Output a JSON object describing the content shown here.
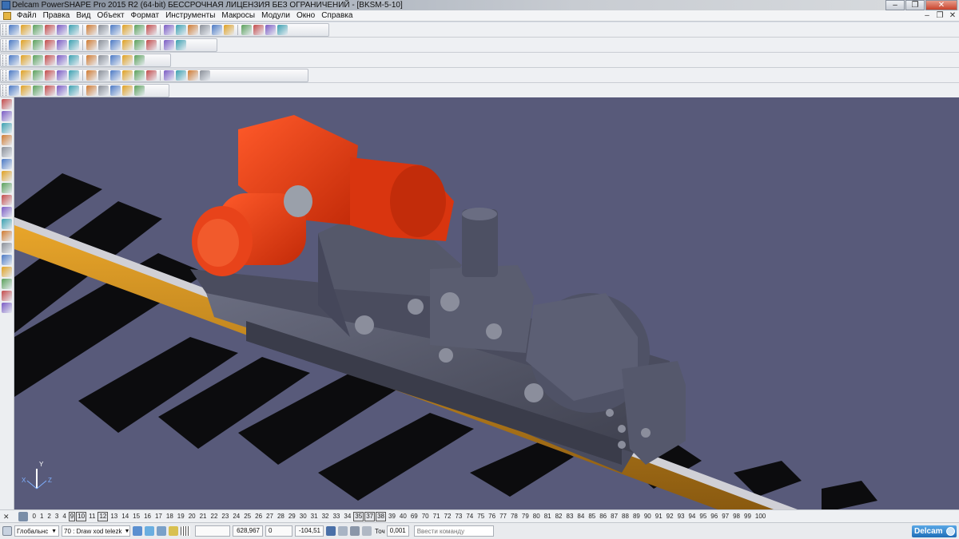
{
  "window": {
    "title": "Delcam PowerSHAPE Pro 2015 R2 (64-bit) БЕССРОЧНАЯ ЛИЦЕНЗИЯ БЕЗ ОГРАНИЧЕНИЙ - [BKSM-5-10]",
    "minimize": "–",
    "restore": "❐",
    "close": "✕"
  },
  "menu": {
    "items": [
      "Файл",
      "Правка",
      "Вид",
      "Объект",
      "Формат",
      "Инструменты",
      "Макросы",
      "Модули",
      "Окно",
      "Справка"
    ],
    "mdi": [
      "–",
      "❐",
      "✕"
    ]
  },
  "toolbars": {
    "row1_icons": [
      "new-file-icon",
      "open-icon",
      "save-icon",
      "save-as-icon",
      "print-icon",
      "print-preview-icon",
      "cut-icon",
      "copy-icon",
      "paste-icon",
      "delete-icon",
      "undo-icon",
      "redo-icon",
      "select-icon",
      "line-icon",
      "arc-icon",
      "curve-icon",
      "circle-icon",
      "dimension-icon",
      "workplane-icon",
      "shade-icon",
      "lights-icon",
      "tools-icon"
    ],
    "row2_icons": [
      "view-top-icon",
      "view-front-icon",
      "view-side-icon",
      "view-iso1-icon",
      "view-iso2-icon",
      "zoom-in-icon",
      "zoom-out-icon",
      "zoom-fit-icon",
      "zoom-box-icon",
      "rotate-icon",
      "shaded-icon",
      "wireframe-icon",
      "hidden-line-icon",
      "help-icon"
    ],
    "row3_icons": [
      "layer-icon",
      "part-icon",
      "sphere-icon",
      "cylinder-icon",
      "cone-icon",
      "torus-icon",
      "block-icon",
      "extrude-icon",
      "revolve-icon",
      "sweep-icon",
      "cube-icon"
    ],
    "row4_icons": [
      "solid-icon",
      "boolean-add-icon",
      "boolean-sub-icon",
      "fillet-icon",
      "chamfer-icon",
      "shell-icon",
      "draft-icon",
      "cut-icon-2",
      "feature-icon",
      "pattern-icon",
      "mirror-icon",
      "surface-icon",
      "trim-icon",
      "offset-icon",
      "analysis-icon",
      "history-icon"
    ],
    "row5_icons": [
      "assembly-icon",
      "component-icon",
      "constraint-icon",
      "explode-icon",
      "bom-icon",
      "drawing-icon",
      "section-icon",
      "render-icon",
      "measure-icon",
      "check-icon",
      "export-icon"
    ]
  },
  "left_toolbar_icons": [
    "select-arrow-icon",
    "edit-icon",
    "point-icon",
    "copy-shape-icon",
    "layers-icon",
    "box-icon",
    "sheet-icon",
    "spring-icon",
    "drill-icon",
    "electrode-icon",
    "mold-icon",
    "tool-icon",
    "die-icon",
    "surface-icon",
    "shade-icon",
    "analysis-icon",
    "globe-icon",
    "render-icon"
  ],
  "viewport": {
    "background": "#585a7a",
    "axis": {
      "x": "X",
      "y": "Y",
      "z": "Z"
    }
  },
  "levels": {
    "values": [
      "0",
      "1",
      "2",
      "3",
      "4",
      "9",
      "10",
      "11",
      "12",
      "13",
      "14",
      "15",
      "16",
      "17",
      "18",
      "19",
      "20",
      "21",
      "22",
      "23",
      "24",
      "25",
      "26",
      "27",
      "28",
      "29",
      "30",
      "31",
      "32",
      "33",
      "34",
      "35",
      "37",
      "38",
      "39",
      "40",
      "69",
      "70",
      "71",
      "72",
      "73",
      "74",
      "75",
      "76",
      "77",
      "78",
      "79",
      "80",
      "81",
      "82",
      "83",
      "84",
      "85",
      "86",
      "87",
      "88",
      "89",
      "90",
      "91",
      "92",
      "93",
      "94",
      "95",
      "96",
      "97",
      "98",
      "99",
      "100"
    ],
    "active": [
      "9",
      "10",
      "12",
      "35",
      "37",
      "38"
    ]
  },
  "status": {
    "workplane": "Глобальнс",
    "level_select": "70 : Draw xod telezk",
    "x": "628,967",
    "y": "0",
    "z": "-104,51",
    "tolerance_label": "Точ",
    "tolerance": "0,001",
    "command_placeholder": "Ввести команду",
    "brand": "Delcam"
  }
}
